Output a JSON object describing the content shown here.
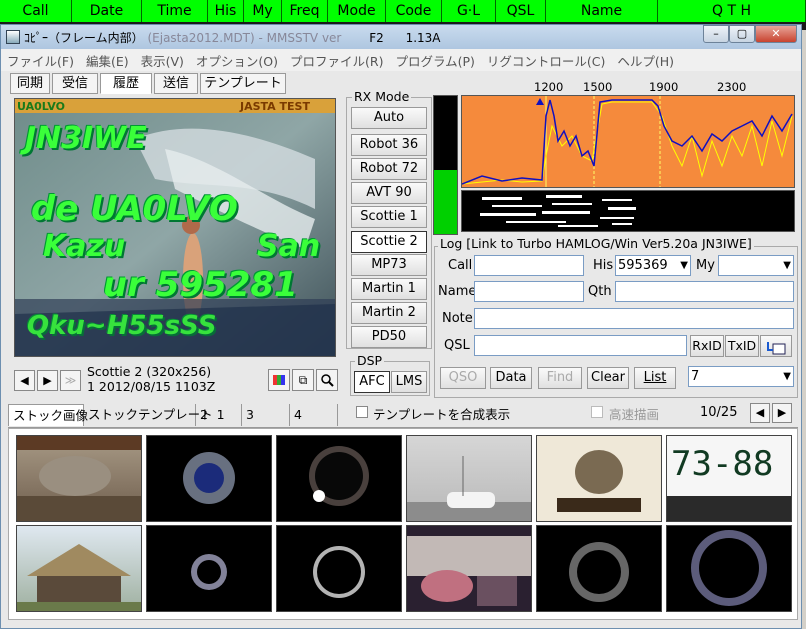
{
  "header": {
    "columns": [
      "Call",
      "Date",
      "Time",
      "His",
      "My",
      "Freq",
      "Mode",
      "Code",
      "G·L",
      "QSL",
      "Name",
      "Q T H"
    ]
  },
  "window": {
    "title": "ｺﾋﾟｰ（フレーム内部）",
    "hidden_title": "Ejasta2012.MDT) - MMSSTV ver",
    "f2_label": "F2",
    "version": "1.13A",
    "minimize": "–",
    "maximize": "▢",
    "close": "✕"
  },
  "menu": [
    "ファイル(F)",
    "編集(E)",
    "表示(V)",
    "オプション(O)",
    "プロファイル(R)",
    "プログラム(P)",
    "リグコントロール(C)",
    "ヘルプ(H)"
  ],
  "top_tabs": [
    "同期",
    "受信",
    "履歴",
    "送信",
    "テンプレート"
  ],
  "active_top_tab": "履歴",
  "image": {
    "corner_left": "UA0LVO",
    "corner_right": "JASTA TEST",
    "line1": "JN3IWE",
    "line2": "de UA0LVO",
    "line3a": "Kazu",
    "line3b": "San",
    "line4": "ur 595281",
    "line5": "Qku~H55sSS"
  },
  "nav": {
    "prev": "◀",
    "next": "▶",
    "last": "≫",
    "mode_info": "Scottie 2 (320x256)",
    "date_info": "1  2012/08/15 1103Z"
  },
  "rx_mode": {
    "label": "RX Mode",
    "buttons": [
      "Auto",
      "Robot 36",
      "Robot 72",
      "AVT 90",
      "Scottie 1",
      "Scottie 2",
      "MP73",
      "Martin 1",
      "Martin 2",
      "PD50"
    ],
    "selected": "Scottie 2"
  },
  "dsp": {
    "label": "DSP",
    "afc": "AFC",
    "lms": "LMS"
  },
  "spectrum": {
    "scale": [
      "1200",
      "1500",
      "1900",
      "2300"
    ],
    "bg_color": "#f58a3c",
    "trace_color": "#1010c0",
    "trace2_color": "#ffff00"
  },
  "log": {
    "label": "Log [Link to Turbo HAMLOG/Win Ver5.20a JN3IWE]",
    "call_label": "Call",
    "call_value": "",
    "his_label": "His",
    "his_value": "595369",
    "my_label": "My",
    "my_value": "",
    "name_label": "Name",
    "name_value": "",
    "qth_label": "Qth",
    "qth_value": "",
    "note_label": "Note",
    "note_value": "",
    "qsl_label": "QSL",
    "qsl_value": "",
    "rxid": "RxID",
    "txid": "TxID",
    "buttons": [
      "QSO",
      "Data",
      "Find",
      "Clear",
      "List"
    ],
    "list_value": "7"
  },
  "bottom_tabs": [
    "ストック画像",
    "ストックテンプレート 1",
    "2",
    "3",
    "4"
  ],
  "template_check": "テンプレートを合成表示",
  "hispeed_check": "高速描画",
  "page_counter": "10/25"
}
